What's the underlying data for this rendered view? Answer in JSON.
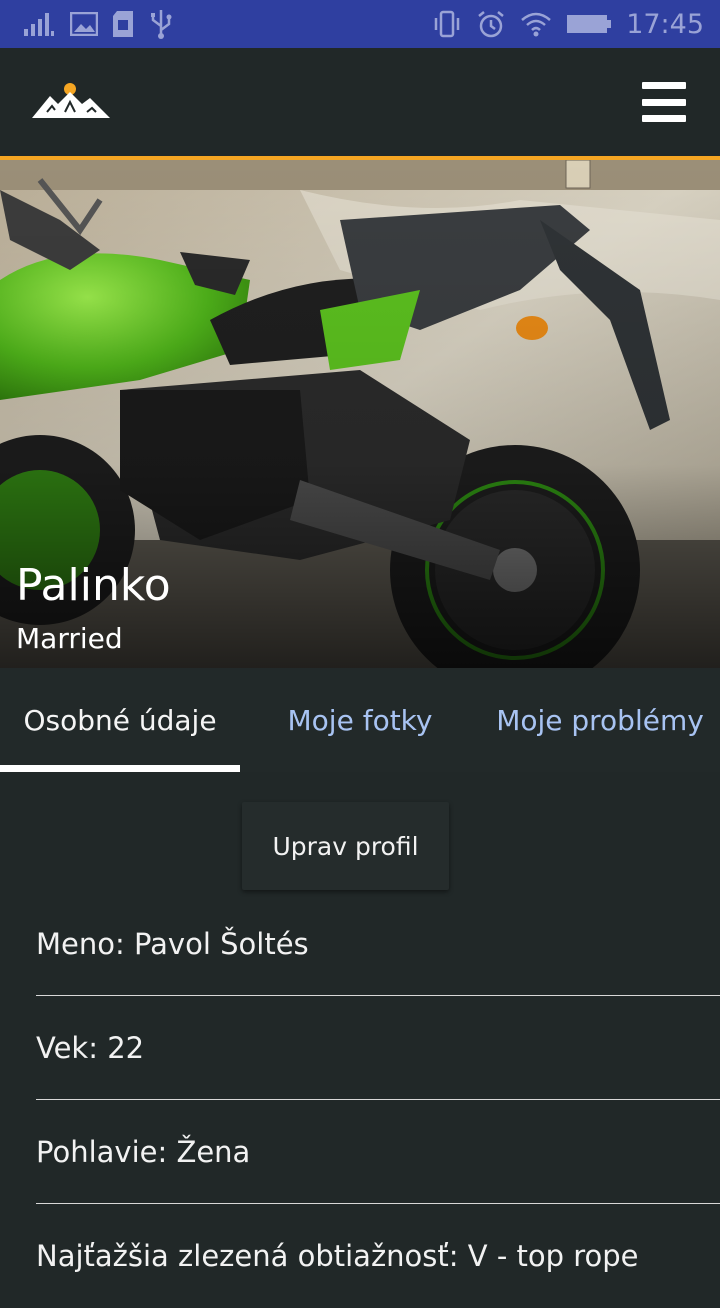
{
  "status_bar": {
    "time": "17:45",
    "icons_left": [
      "signal-icon",
      "image-icon",
      "sd-card-icon",
      "usb-icon"
    ],
    "icons_right": [
      "vibrate-icon",
      "alarm-icon",
      "wifi-icon",
      "battery-icon"
    ]
  },
  "app_bar": {
    "logo": "mountain-logo",
    "menu_icon": "hamburger-menu-icon",
    "accent_color": "#f5a623"
  },
  "profile": {
    "name": "Palinko",
    "status": "Married"
  },
  "tabs": [
    {
      "label": "Osobné údaje",
      "active": true
    },
    {
      "label": "Moje fotky",
      "active": false
    },
    {
      "label": "Moje problémy",
      "active": false
    }
  ],
  "edit_button": {
    "label": "Uprav profil"
  },
  "info": [
    {
      "text": "Meno: Pavol Šoltés"
    },
    {
      "text": "Vek: 22"
    },
    {
      "text": "Pohlavie: Žena"
    },
    {
      "text": "Najťažšia zlezená obtiažnosť: V - top rope"
    }
  ],
  "colors": {
    "status_bar": "#2f3fa0",
    "background": "#212828",
    "tab_inactive": "#a8c3f2",
    "indicator": "#ffffff"
  }
}
